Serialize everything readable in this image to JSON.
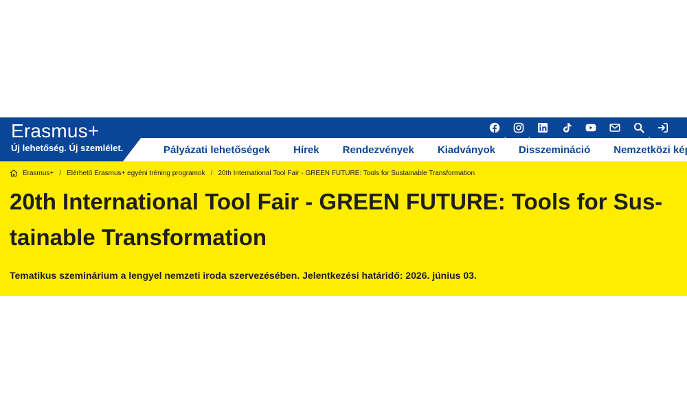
{
  "brand": {
    "name": "Erasmus+",
    "tagline": "Új lehetőség. Új szemlélet."
  },
  "icons": [
    "facebook-icon",
    "instagram-icon",
    "linkedin-icon",
    "tiktok-icon",
    "youtube-icon",
    "mail-icon",
    "search-icon",
    "login-icon"
  ],
  "nav": {
    "items": [
      {
        "label": "Pályázati lehetőségek"
      },
      {
        "label": "Hírek"
      },
      {
        "label": "Rendezvények"
      },
      {
        "label": "Kiadványok"
      },
      {
        "label": "Disszemináció"
      },
      {
        "label": "Nemzetközi képzések"
      }
    ]
  },
  "breadcrumb": {
    "items": [
      {
        "label": "Erasmus+"
      },
      {
        "label": "Elérhető Erasmus+ egyéni tréning programok"
      },
      {
        "label": "20th International Tool Fair - GREEN FUTURE: Tools for Sustainable Transformation"
      }
    ],
    "separator": "/"
  },
  "page": {
    "title": "20th International Tool Fair - GREEN FUTURE: Tools for Sus-tainable Transformation",
    "subtitle": "Tematikus szeminárium a lengyel nemzeti iroda szervezésében. Jelentkezési határidő: 2026. június 03."
  },
  "colors": {
    "primary_blue": "#0b4598",
    "accent_yellow": "#ffed00",
    "nav_background": "#ffffff",
    "text_dark": "#1f1f1f"
  }
}
